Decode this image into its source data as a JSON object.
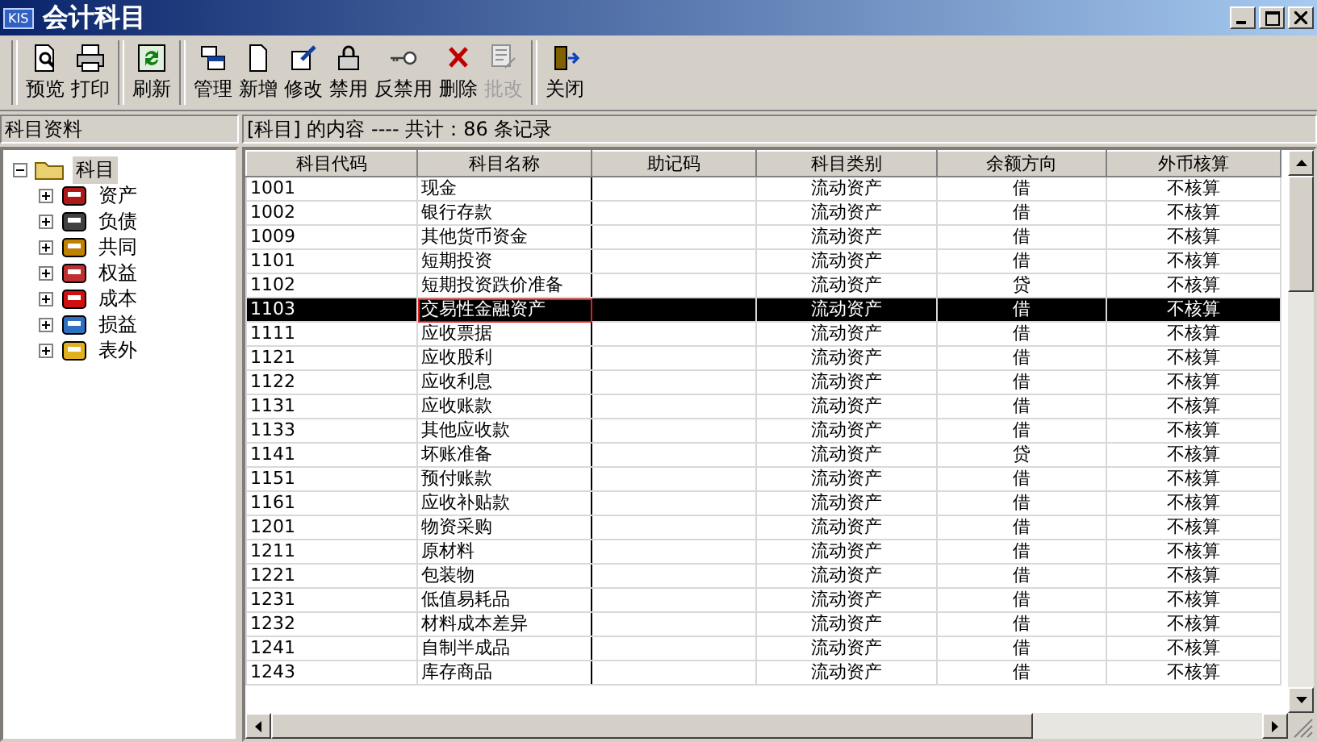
{
  "window": {
    "title": "会计科目",
    "logo": "KIS"
  },
  "toolbar": [
    {
      "buttons": [
        {
          "kind": "preview",
          "label": "预览",
          "disabled": false
        },
        {
          "kind": "print",
          "label": "打印",
          "disabled": false
        }
      ]
    },
    {
      "buttons": [
        {
          "kind": "refresh",
          "label": "刷新",
          "disabled": false
        }
      ]
    },
    {
      "buttons": [
        {
          "kind": "manage",
          "label": "管理",
          "disabled": false
        },
        {
          "kind": "new",
          "label": "新增",
          "disabled": false
        },
        {
          "kind": "edit",
          "label": "修改",
          "disabled": false
        },
        {
          "kind": "lock",
          "label": "禁用",
          "disabled": false
        },
        {
          "kind": "key",
          "label": "反禁用",
          "disabled": false
        },
        {
          "kind": "delete",
          "label": "删除",
          "disabled": false
        },
        {
          "kind": "batch",
          "label": "批改",
          "disabled": true
        }
      ]
    },
    {
      "buttons": [
        {
          "kind": "close",
          "label": "关闭",
          "disabled": false
        }
      ]
    }
  ],
  "sidebar": {
    "title": "科目资料",
    "tree": {
      "label": "科目",
      "expanded": true,
      "selected": true,
      "children": [
        {
          "label": "资产",
          "expanded": false
        },
        {
          "label": "负债",
          "expanded": false
        },
        {
          "label": "共同",
          "expanded": false
        },
        {
          "label": "权益",
          "expanded": false
        },
        {
          "label": "成本",
          "expanded": false
        },
        {
          "label": "损益",
          "expanded": false
        },
        {
          "label": "表外",
          "expanded": false
        }
      ]
    }
  },
  "table": {
    "caption": "[科目] 的内容 ---- 共计：86 条记录",
    "columns": [
      "科目代码",
      "科目名称",
      "助记码",
      "科目类别",
      "余额方向",
      "外币核算"
    ],
    "rows": [
      {
        "cells": [
          "1001",
          "现金",
          "",
          "流动资产",
          "借",
          "不核算"
        ],
        "selected": false
      },
      {
        "cells": [
          "1002",
          "银行存款",
          "",
          "流动资产",
          "借",
          "不核算"
        ],
        "selected": false
      },
      {
        "cells": [
          "1009",
          "其他货币资金",
          "",
          "流动资产",
          "借",
          "不核算"
        ],
        "selected": false
      },
      {
        "cells": [
          "1101",
          "短期投资",
          "",
          "流动资产",
          "借",
          "不核算"
        ],
        "selected": false
      },
      {
        "cells": [
          "1102",
          "短期投资跌价准备",
          "",
          "流动资产",
          "贷",
          "不核算"
        ],
        "selected": false
      },
      {
        "cells": [
          "1103",
          "交易性金融资产",
          "",
          "流动资产",
          "借",
          "不核算"
        ],
        "selected": true
      },
      {
        "cells": [
          "1111",
          "应收票据",
          "",
          "流动资产",
          "借",
          "不核算"
        ],
        "selected": false
      },
      {
        "cells": [
          "1121",
          "应收股利",
          "",
          "流动资产",
          "借",
          "不核算"
        ],
        "selected": false
      },
      {
        "cells": [
          "1122",
          "应收利息",
          "",
          "流动资产",
          "借",
          "不核算"
        ],
        "selected": false
      },
      {
        "cells": [
          "1131",
          "应收账款",
          "",
          "流动资产",
          "借",
          "不核算"
        ],
        "selected": false
      },
      {
        "cells": [
          "1133",
          "其他应收款",
          "",
          "流动资产",
          "借",
          "不核算"
        ],
        "selected": false
      },
      {
        "cells": [
          "1141",
          "坏账准备",
          "",
          "流动资产",
          "贷",
          "不核算"
        ],
        "selected": false
      },
      {
        "cells": [
          "1151",
          "预付账款",
          "",
          "流动资产",
          "借",
          "不核算"
        ],
        "selected": false
      },
      {
        "cells": [
          "1161",
          "应收补贴款",
          "",
          "流动资产",
          "借",
          "不核算"
        ],
        "selected": false
      },
      {
        "cells": [
          "1201",
          "物资采购",
          "",
          "流动资产",
          "借",
          "不核算"
        ],
        "selected": false
      },
      {
        "cells": [
          "1211",
          "原材料",
          "",
          "流动资产",
          "借",
          "不核算"
        ],
        "selected": false
      },
      {
        "cells": [
          "1221",
          "包装物",
          "",
          "流动资产",
          "借",
          "不核算"
        ],
        "selected": false
      },
      {
        "cells": [
          "1231",
          "低值易耗品",
          "",
          "流动资产",
          "借",
          "不核算"
        ],
        "selected": false
      },
      {
        "cells": [
          "1232",
          "材料成本差异",
          "",
          "流动资产",
          "借",
          "不核算"
        ],
        "selected": false
      },
      {
        "cells": [
          "1241",
          "自制半成品",
          "",
          "流动资产",
          "借",
          "不核算"
        ],
        "selected": false
      },
      {
        "cells": [
          "1243",
          "库存商品",
          "",
          "流动资产",
          "借",
          "不核算"
        ],
        "selected": false
      }
    ]
  }
}
